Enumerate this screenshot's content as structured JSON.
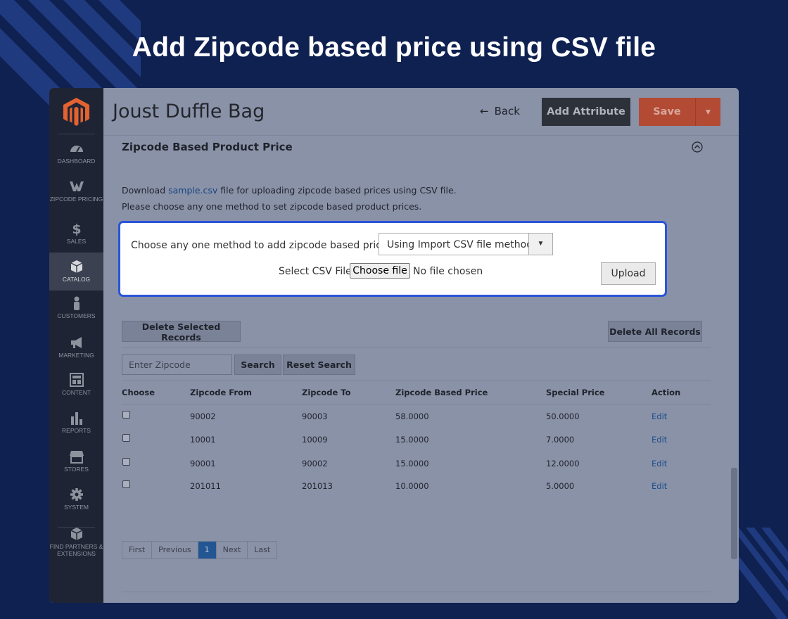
{
  "headline": "Add Zipcode based price using CSV file",
  "sidebar": {
    "items": [
      {
        "label": "DASHBOARD",
        "icon": "dashboard-icon"
      },
      {
        "label": "ZIPCODE PRICING",
        "icon": "zipcode-pricing-icon"
      },
      {
        "label": "SALES",
        "icon": "dollar-icon"
      },
      {
        "label": "CATALOG",
        "icon": "catalog-box-icon",
        "active": true
      },
      {
        "label": "CUSTOMERS",
        "icon": "customer-icon"
      },
      {
        "label": "MARKETING",
        "icon": "megaphone-icon"
      },
      {
        "label": "CONTENT",
        "icon": "content-icon"
      },
      {
        "label": "REPORTS",
        "icon": "bar-chart-icon"
      },
      {
        "label": "STORES",
        "icon": "store-icon"
      },
      {
        "label": "SYSTEM",
        "icon": "gear-icon"
      },
      {
        "label": "FIND PARTNERS & EXTENSIONS",
        "icon": "extensions-box-icon"
      }
    ]
  },
  "header": {
    "title": "Joust Duffle Bag",
    "back_label": "Back",
    "add_attribute_label": "Add Attribute",
    "save_label": "Save"
  },
  "section": {
    "title": "Zipcode Based Product Price",
    "info_prefix": "Download ",
    "info_link": "sample.csv",
    "info_suffix": " file for uploading zipcode based prices using CSV file.",
    "info_line2": "Please choose any one method to set zipcode based product prices."
  },
  "method": {
    "label": "Choose any one method to add zipcode based prices:",
    "selected": "Using Import CSV file method",
    "csv_label": "Select CSV File:",
    "choose_file_label": "Choose file",
    "no_file_text": "No file chosen",
    "upload_label": "Upload"
  },
  "actions": {
    "delete_selected": "Delete Selected Records",
    "delete_all": "Delete All Records",
    "search_placeholder": "Enter Zipcode",
    "search_label": "Search",
    "reset_label": "Reset Search"
  },
  "table": {
    "headers": [
      "Choose",
      "Zipcode From",
      "Zipcode To",
      "Zipcode Based Price",
      "Special Price",
      "Action"
    ],
    "rows": [
      {
        "from": "90002",
        "to": "90003",
        "price": "58.0000",
        "special": "50.0000",
        "action": "Edit"
      },
      {
        "from": "10001",
        "to": "10009",
        "price": "15.0000",
        "special": "7.0000",
        "action": "Edit"
      },
      {
        "from": "90001",
        "to": "90002",
        "price": "15.0000",
        "special": "12.0000",
        "action": "Edit"
      },
      {
        "from": "201011",
        "to": "201013",
        "price": "10.0000",
        "special": "5.0000",
        "action": "Edit"
      }
    ]
  },
  "pager": {
    "first": "First",
    "previous": "Previous",
    "current": "1",
    "next": "Next",
    "last": "Last"
  },
  "colors": {
    "background": "#0f2151",
    "highlight_border": "#2a54d8",
    "save_button": "#b34a34",
    "sidebar": "#1e2434"
  }
}
